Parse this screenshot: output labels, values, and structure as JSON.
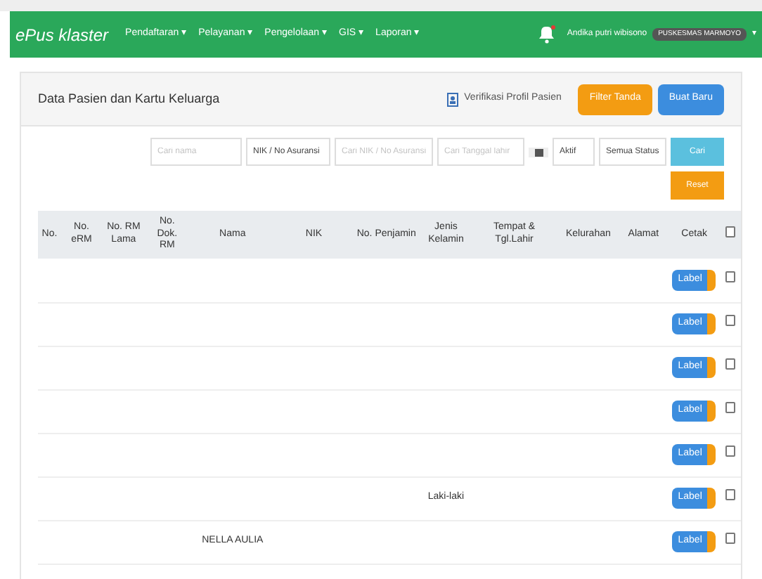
{
  "navbar": {
    "logo": "ePus klaster",
    "menu": [
      {
        "label": "Pendaftaran ▾"
      },
      {
        "label": "Pelayanan ▾"
      },
      {
        "label": "Pengelolaan ▾"
      },
      {
        "label": "GIS ▾"
      },
      {
        "label": "Laporan ▾"
      }
    ],
    "notification": true,
    "user": "Andika putri wibisono",
    "unit": "PUSKESMAS MARMOYO",
    "caret": "▾"
  },
  "panel": {
    "title": "Data Pasien dan Kartu Keluarga",
    "verify_link": "Verifikasi Profil Pasien",
    "buttons": [
      {
        "label": "Filter Tanda",
        "kind": "warning"
      },
      {
        "label": "Buat Baru",
        "kind": "primary"
      }
    ]
  },
  "filters": {
    "name": {
      "placeholder": "Cari nama"
    },
    "id_type": "NIK / No Asuransi",
    "id": {
      "placeholder": "Cari NIK / No Asuransi"
    },
    "birth_date": {
      "placeholder": "Cari Tanggal lahir"
    },
    "active": "Aktif",
    "status": "Semua Status",
    "search_button": "Cari",
    "reset_button": "Reset"
  },
  "table": {
    "columns": [
      "No.",
      "No. eRM",
      "No. RM Lama",
      "No. Dok. RM",
      "Nama",
      "NIK",
      "No. Penjamin",
      "Jenis Kelamin",
      "Tempat & Tgl.Lahir",
      "Kelurahan",
      "Alamat",
      "Cetak"
    ],
    "all_checked": false,
    "rows": [
      {
        "cells": {},
        "print_button": "Label",
        "checked": false
      },
      {
        "cells": {},
        "print_button": "Label",
        "checked": false
      },
      {
        "cells": {},
        "print_button": "Label",
        "checked": false
      },
      {
        "cells": {},
        "print_button": "Label",
        "checked": false
      },
      {
        "cells": {},
        "print_button": "Label",
        "checked": false
      },
      {
        "cells": {
          "7": "Laki-laki"
        },
        "print_button": "Label",
        "checked": false
      },
      {
        "cells": {
          "4": "NELLA AULIA"
        },
        "print_button": "Label",
        "checked": false
      }
    ]
  }
}
